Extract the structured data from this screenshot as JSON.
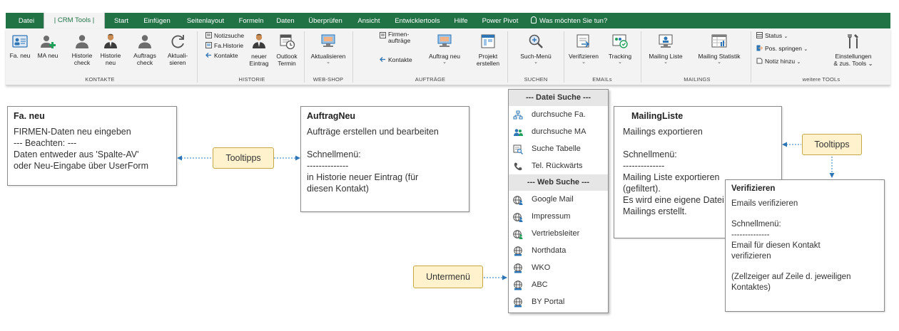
{
  "tabs": [
    "Datei",
    "| CRM Tools |",
    "Start",
    "Einfügen",
    "Seitenlayout",
    "Formeln",
    "Daten",
    "Überprüfen",
    "Ansicht",
    "Entwicklertools",
    "Hilfe",
    "Power Pivot"
  ],
  "tell_me": "Was möchten Sie tun?",
  "ribbon": {
    "kontakte": {
      "fa_neu": "Fa. neu",
      "ma_neu": "MA neu",
      "historie_check": [
        "Historie",
        "check"
      ],
      "historie_neu": [
        "Historie",
        "neu"
      ],
      "auftrags_check": [
        "Auftrags",
        "check"
      ],
      "aktualisieren": [
        "Aktuali-",
        "sieren"
      ],
      "group_label": "KONTAKTE"
    },
    "historie": {
      "notizsuche": "Notizsuche",
      "fa_historie": "Fa.Historie",
      "kontakte": "Kontakte",
      "neuer_eintrag": [
        "neuer",
        "Eintrag"
      ],
      "outlook_termin": [
        "Outlook",
        "Termin"
      ],
      "group_label": "HISTORIE"
    },
    "webshop": {
      "aktualisieren": "Aktualisieren",
      "group_label": "WEB-SHOP"
    },
    "auftraege": {
      "firmen_auftraege": [
        "Firmen-",
        "aufträge"
      ],
      "kontakte": "Kontakte",
      "auftrag_neu": "Auftrag neu",
      "projekt_erstellen": [
        "Projekt",
        "erstellen"
      ],
      "group_label": "AUFTRÄGE"
    },
    "suchen": {
      "such_menu": "Such-Menü",
      "group_label": "SUCHEN"
    },
    "emails": {
      "verifizieren": "Verifizieren",
      "tracking": "Tracking",
      "group_label": "EMAILs"
    },
    "mailings": {
      "mailing_liste": "Mailing Liste",
      "mailing_statistik": "Mailing Statistik",
      "group_label": "MAILINGS"
    },
    "weitere": {
      "status": "Status",
      "pos_springen": "Pos. springen",
      "notiz_hinzu": "Notiz hinzu",
      "einstellungen": [
        "Einstellungen",
        "& zus. Tools"
      ],
      "group_label": "weitere TOOLs"
    }
  },
  "tooltips": {
    "fa_neu": {
      "title": "Fa. neu",
      "lines": [
        "FIRMEN-Daten neu eingeben",
        "--- Beachten: ---",
        "Daten entweder aus 'Spalte-AV'",
        "oder Neu-Eingabe über UserForm"
      ]
    },
    "auftrag_neu": {
      "title": "AuftragNeu",
      "lines": [
        "Aufträge erstellen und bearbeiten",
        "Schnellmenü:",
        "--------------",
        "in Historie neuer Eintrag (für",
        "diesen Kontakt)"
      ]
    },
    "mailing_liste": {
      "title": "MailingListe",
      "lines": [
        "Mailings exportieren",
        "Schnellmenü:",
        "--------------",
        "Mailing Liste exportieren",
        "(gefiltert).",
        "Es wird eine eigene Datei für",
        "Mailings erstellt."
      ]
    },
    "verifizieren": {
      "title": "Verifizieren",
      "lines": [
        "Emails verifizieren",
        "Schnellmenü:",
        "--------------",
        "Email für diesen Kontakt",
        "verifizieren",
        "(Zellzeiger auf Zeile d. jeweiligen",
        "Kontaktes)"
      ]
    }
  },
  "callouts": {
    "tooltipps_left": "Tooltipps",
    "tooltipps_right": "Tooltipps",
    "untermenue": "Untermenü"
  },
  "menu": {
    "header_datei": "--- Datei Suche ---",
    "datei_items": [
      {
        "label": "durchsuche Fa.",
        "icon": "org-chart-icon"
      },
      {
        "label": "durchsuche MA",
        "icon": "people-icon"
      },
      {
        "label": "Suche Tabelle",
        "icon": "table-search-icon"
      },
      {
        "label": "Tel. Rückwärts",
        "icon": "phone-icon"
      }
    ],
    "header_web": "--- Web Suche ---",
    "web_items": [
      {
        "label": "Google Mail",
        "icon": "globe-person-icon"
      },
      {
        "label": "Impressum",
        "icon": "globe-person-icon"
      },
      {
        "label": "Vertriebsleiter",
        "icon": "globe-person-icon"
      },
      {
        "label": "Northdata",
        "icon": "globe-network-icon"
      },
      {
        "label": "WKO",
        "icon": "globe-network-icon"
      },
      {
        "label": "ABC",
        "icon": "globe-network-icon"
      },
      {
        "label": "BY Portal",
        "icon": "globe-network-icon"
      }
    ]
  },
  "colors": {
    "ribbon_green": "#217346",
    "callout_fill": "#fff2cc",
    "arrow_blue": "#2e75b6"
  }
}
